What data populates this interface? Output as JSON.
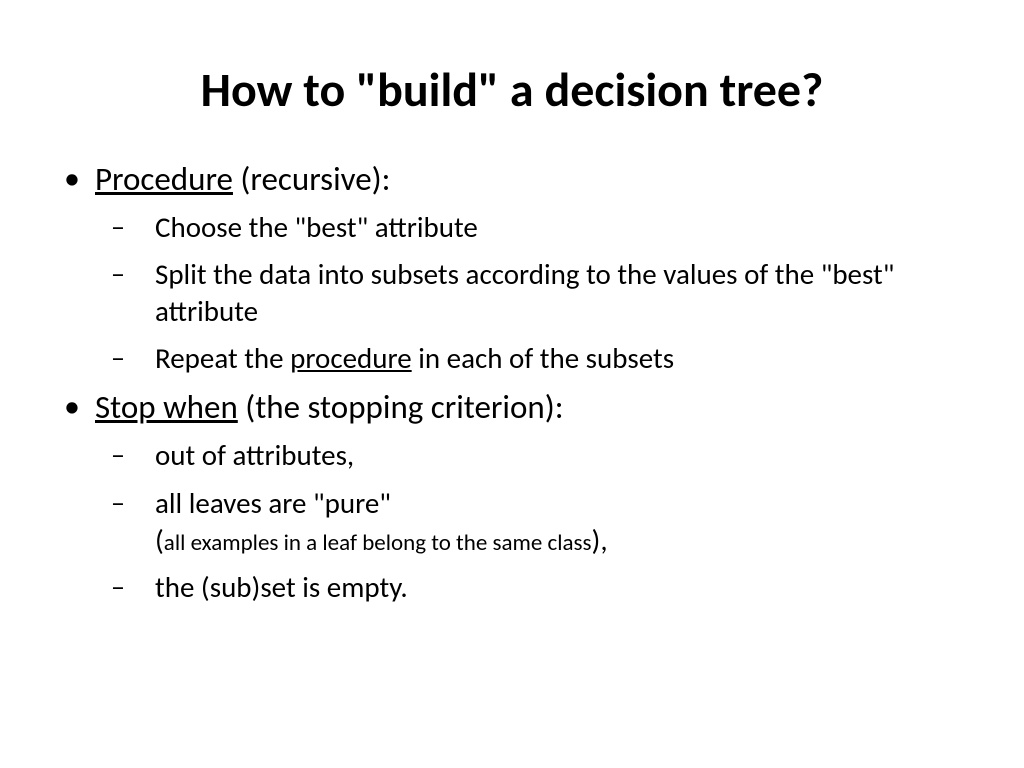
{
  "title": "How to \"build\" a decision tree?",
  "bullets": {
    "b1": {
      "underlined": "Procedure",
      "rest": " (recursive):",
      "sub": {
        "s1": "Choose the \"best\" attribute",
        "s2": "Split the data into subsets according to the values of the \"best\" attribute",
        "s3_before": "Repeat the ",
        "s3_underlined": "procedure",
        "s3_after": " in each of the subsets"
      }
    },
    "b2": {
      "underlined": "Stop when",
      "rest": " (the stopping criterion):",
      "sub": {
        "s1": "out of attributes,",
        "s2_line1": "all leaves are \"pure\"",
        "s2_paren_open": "(",
        "s2_small": "all examples in a leaf belong to the same class",
        "s2_paren_close": "),",
        "s3": "the (sub)set is empty."
      }
    }
  }
}
